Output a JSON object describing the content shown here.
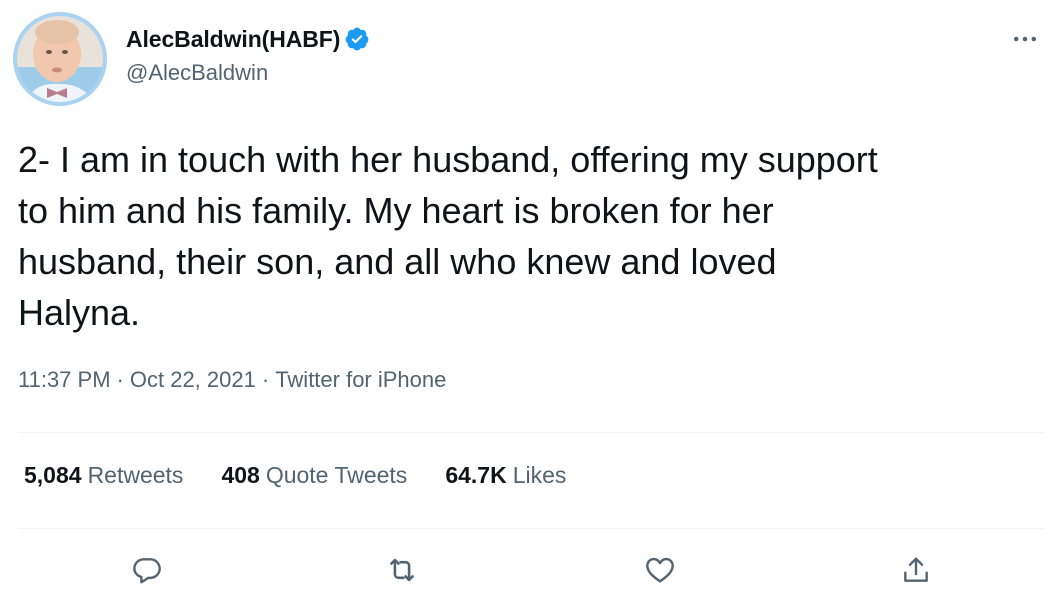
{
  "user": {
    "display_name": "AlecBaldwin(HABF)",
    "handle": "@AlecBaldwin",
    "verified": true,
    "verified_color": "#1d9bf0"
  },
  "tweet": {
    "text": "2- I am in touch with her husband, offering my support\nto him and his family. My heart is broken for her\nhusband, their son, and all who knew and loved\nHalyna.",
    "time": "11:37 PM",
    "separator": "·",
    "date": "Oct 22, 2021",
    "source": "Twitter for iPhone"
  },
  "stats": {
    "retweets_count": "5,084",
    "retweets_label": "Retweets",
    "quotes_count": "408",
    "quotes_label": "Quote Tweets",
    "likes_count": "64.7K",
    "likes_label": "Likes"
  },
  "icons": {
    "more": "more-icon",
    "reply": "reply-icon",
    "retweet": "retweet-icon",
    "like": "heart-icon",
    "share": "share-icon"
  },
  "colors": {
    "text_primary": "#0f1419",
    "text_secondary": "#536471",
    "divider": "#eff3f4",
    "accent": "#1d9bf0"
  }
}
